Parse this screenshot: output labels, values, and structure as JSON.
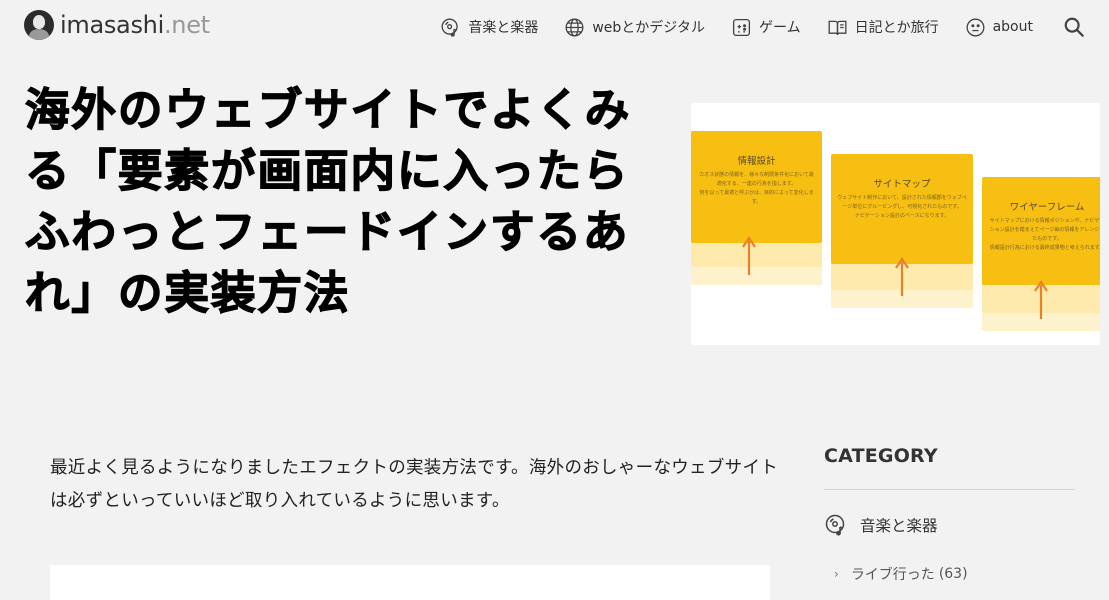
{
  "header": {
    "logo_main": "imasashi",
    "logo_tld": ".net",
    "nav": [
      {
        "label": "音楽と楽器",
        "icon": "music-disc-icon"
      },
      {
        "label": "webとかデジタル",
        "icon": "globe-icon"
      },
      {
        "label": "ゲーム",
        "icon": "gamepad-icon"
      },
      {
        "label": "日記とか旅行",
        "icon": "book-icon"
      },
      {
        "label": "about",
        "icon": "smiley-icon"
      }
    ],
    "search_icon": "search-icon"
  },
  "article": {
    "title": "海外のウェブサイトでよくみる「要素が画面内に入ったらふわっとフェードインするあれ」の実装方法",
    "hero_cards": [
      {
        "title": "情報設計",
        "body": "カオス状態の情報を、様々な制限条件化において最適化する、一連の行為を指します。\n何を以って最適と呼ぶかは、目的によって変化します。"
      },
      {
        "title": "サイトマップ",
        "body": "ウェブサイト制作において、設計された情報郡をウェブページ単位にグルーピングし、可視化されたものです。\nナビゲーション設計のベースになります。"
      },
      {
        "title": "ワイヤーフレーム",
        "body": "サイトマップにおける情報ポジションや、ナビゲーション設計を踏まえてページ毎の情報をアレンジしたものです。\n情報設計行為における最終成果物と考えられます。"
      }
    ],
    "intro": "最近よく見るようになりましたエフェクトの実装方法です。海外のおしゃーなウェブサイトは必ずといっていいほど取り入れているように思います。"
  },
  "sidebar": {
    "heading": "CATEGORY",
    "parent": {
      "label": "音楽と楽器",
      "icon": "music-disc-icon"
    },
    "children": [
      {
        "label": "ライブ行った",
        "count": "(63)"
      }
    ],
    "accent_color": "#f8bf13",
    "arrow_color": "#e8822a"
  }
}
